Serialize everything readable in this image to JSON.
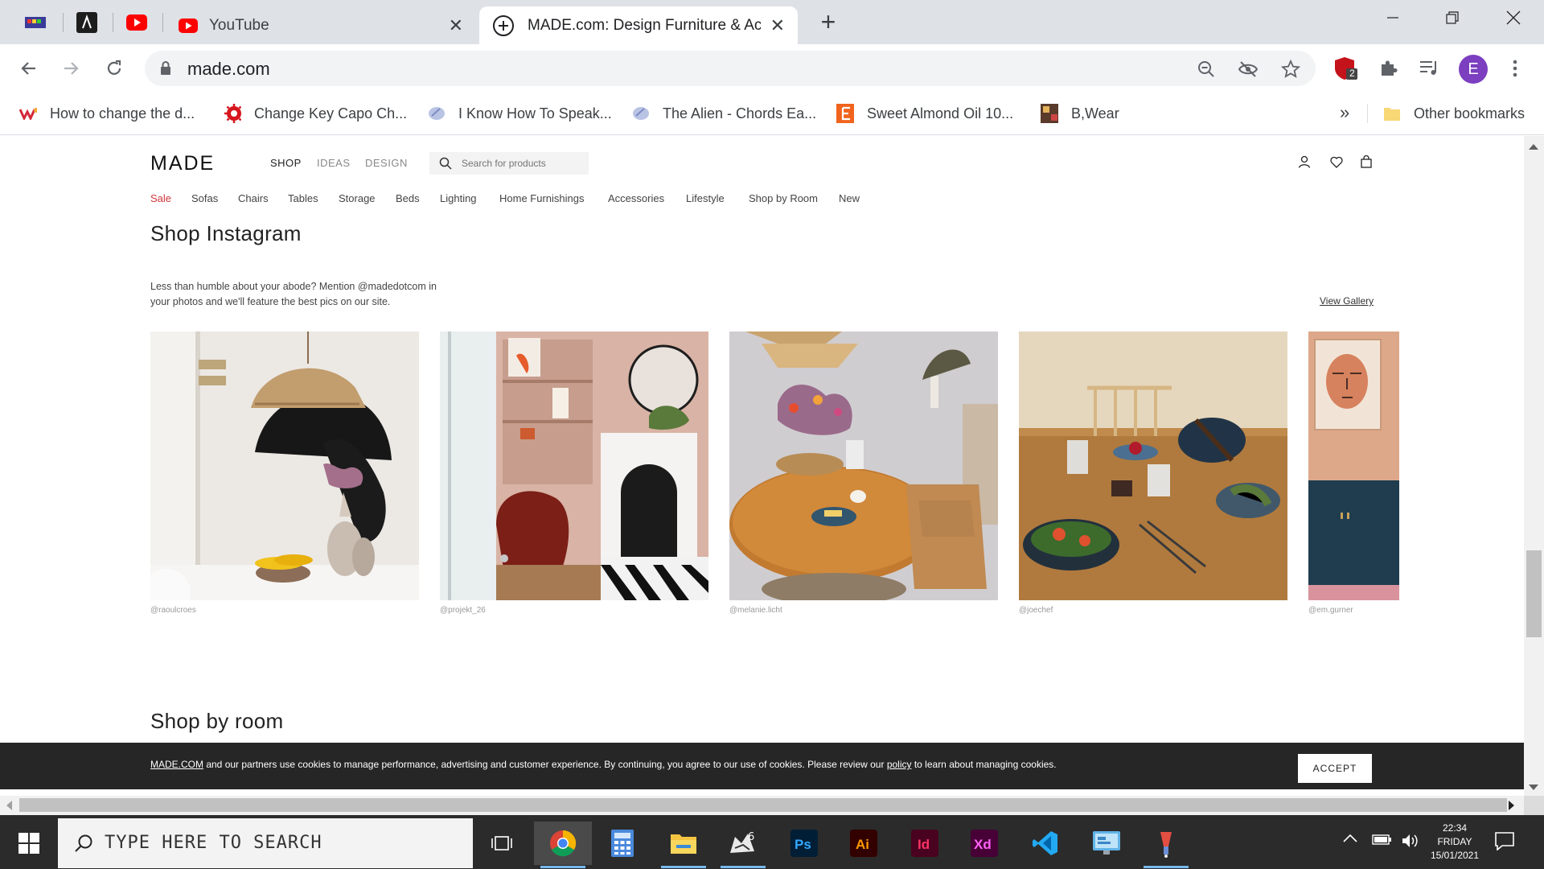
{
  "browser": {
    "tabs": [
      {
        "title": "YouTube",
        "active": false
      },
      {
        "title": "MADE.com: Design Furniture & Acce",
        "active": true
      }
    ],
    "url": "made.com",
    "profile_initial": "E",
    "extension_badge": "2",
    "bookmarks": [
      {
        "label": "How to change the d..."
      },
      {
        "label": "Change Key Capo Ch..."
      },
      {
        "label": "I Know How To Speak..."
      },
      {
        "label": "The Alien - Chords Ea..."
      },
      {
        "label": "Sweet Almond Oil 10..."
      },
      {
        "label": "B,Wear"
      }
    ],
    "bookmarks_more": "»",
    "other_bookmarks": "Other bookmarks"
  },
  "site": {
    "logo": "MADE",
    "topnav": [
      "SHOP",
      "IDEAS",
      "DESIGN"
    ],
    "search_placeholder": "Search for products",
    "categories": [
      "Sale",
      "Sofas",
      "Chairs",
      "Tables",
      "Storage",
      "Beds",
      "Lighting",
      "Home Furnishings",
      "Accessories",
      "Lifestyle",
      "Shop by Room",
      "New"
    ],
    "instagram": {
      "title": "Shop Instagram",
      "intro_line1": "Less than humble about your abode? Mention @madedotcom in",
      "intro_line2": "your photos and we'll feature the best pics on our site.",
      "view_gallery": "View Gallery",
      "posts": [
        {
          "credit": "@raoulcroes"
        },
        {
          "credit": "@projekt_26"
        },
        {
          "credit": "@melanie.licht"
        },
        {
          "credit": "@joechef"
        },
        {
          "credit": "@em.gurner"
        }
      ]
    },
    "shop_by_room": "Shop by room",
    "cookie": {
      "brand": "MADE.COM",
      "text_before_policy": " and our partners use cookies to manage performance, advertising and customer experience. By continuing, you agree to our use of cookies. Please review our ",
      "policy": "policy",
      "text_after_policy": " to learn about managing cookies.",
      "accept": "ACCEPT"
    }
  },
  "taskbar": {
    "search_placeholder": "TYPE HERE TO SEARCH",
    "clock_time": "22:34",
    "clock_day": "FRIDAY",
    "clock_date": "15/01/2021"
  },
  "colors": {
    "sale": "#d0363b",
    "cookie_bg": "#262626",
    "profile": "#7b3fbf"
  }
}
